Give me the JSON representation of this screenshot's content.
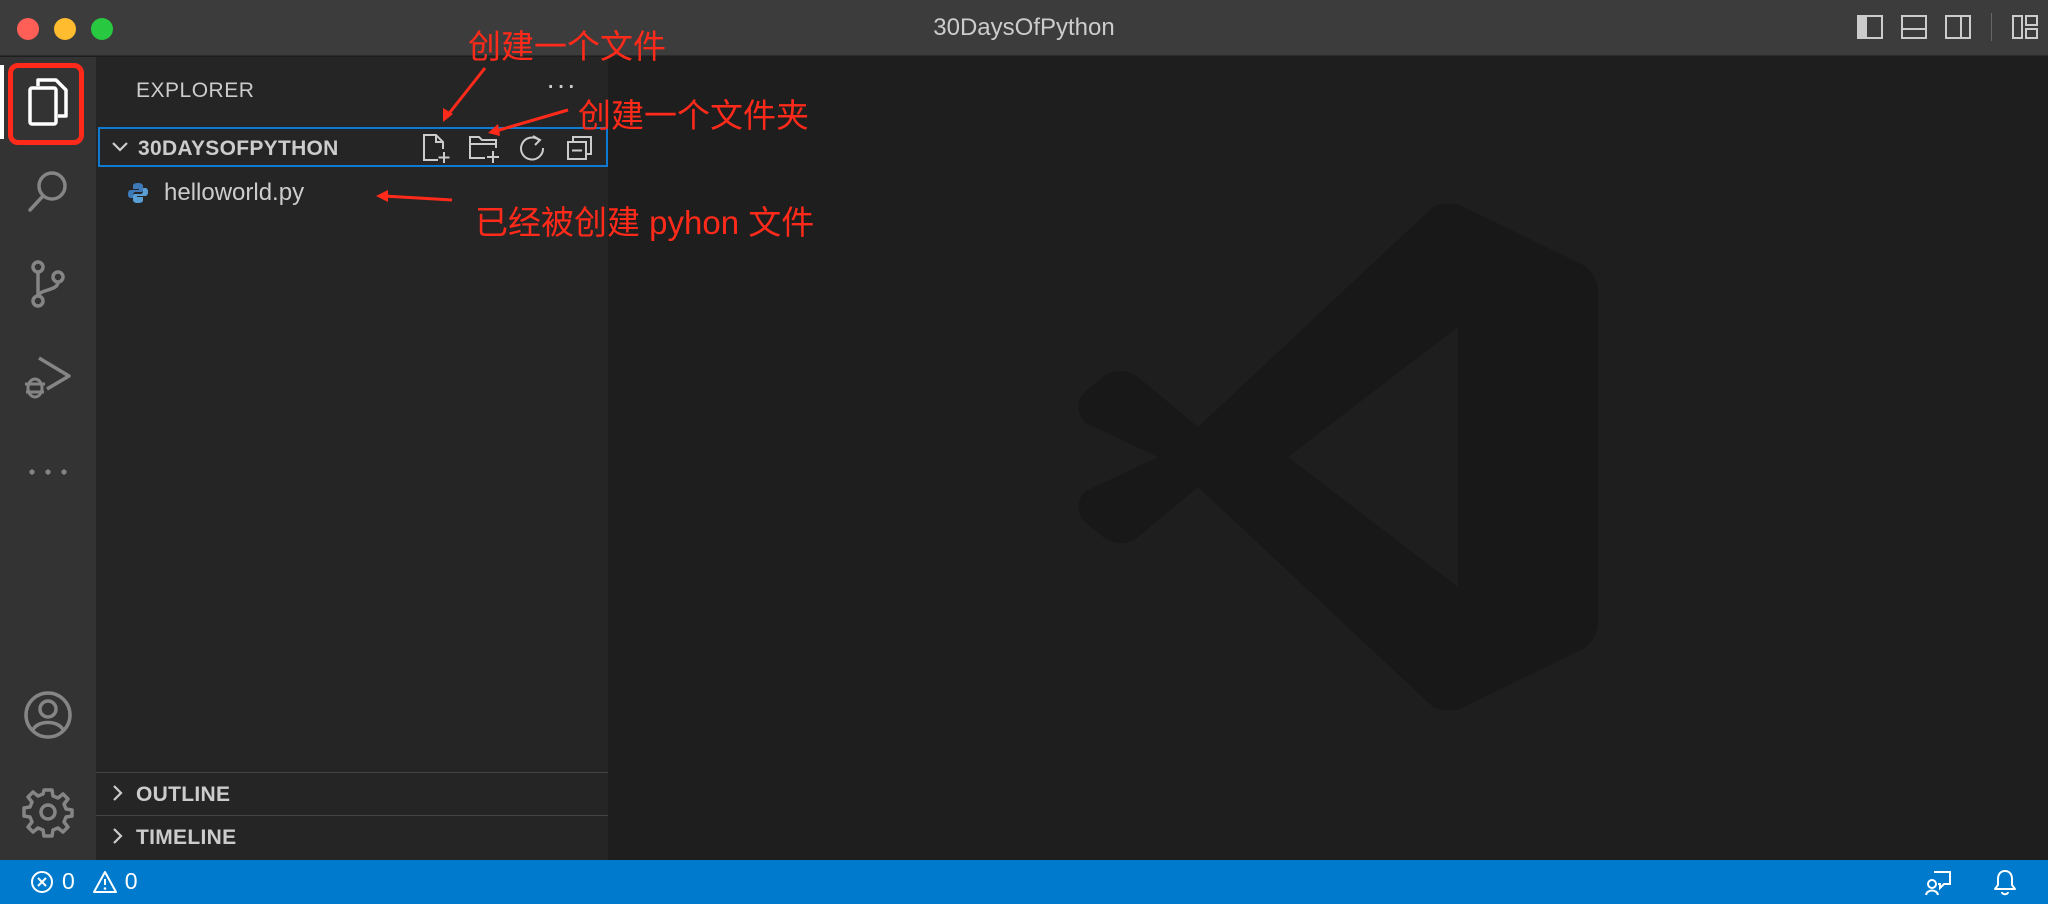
{
  "window": {
    "title": "30DaysOfPython"
  },
  "sidebar": {
    "header": "EXPLORER",
    "more": "···",
    "folder": {
      "name": "30DAYSOFPYTHON"
    },
    "files": [
      {
        "name": "helloworld.py",
        "type": "python"
      }
    ],
    "panels": [
      {
        "label": "OUTLINE"
      },
      {
        "label": "TIMELINE"
      }
    ]
  },
  "statusbar": {
    "errors": "0",
    "warnings": "0"
  },
  "annotations": {
    "new_file": "创建一个文件",
    "new_folder": "创建一个文件夹",
    "created_file": "已经被创建 pyhon 文件"
  },
  "colors": {
    "accent": "#007acc",
    "annotation": "#ff2a1a",
    "focus_border": "#0e7ad1"
  }
}
